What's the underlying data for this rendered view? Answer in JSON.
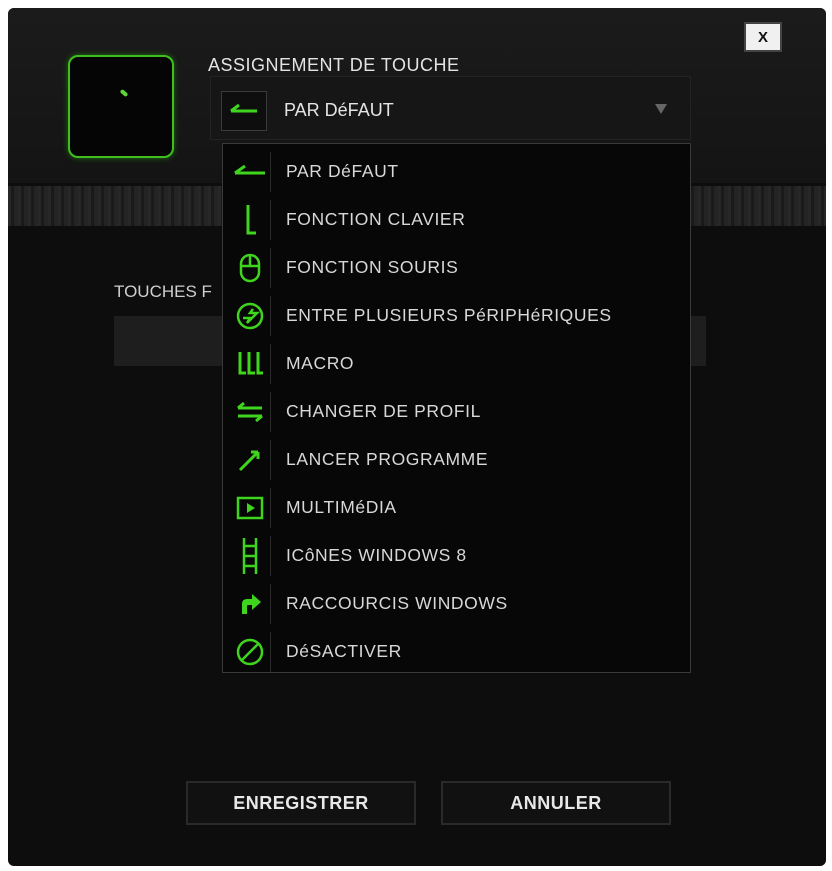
{
  "dialog": {
    "close_label": "X",
    "title": "ASSIGNEMENT DE TOUCHE",
    "side_label": "TOUCHES F",
    "accent_color": "#3fd51f"
  },
  "selector": {
    "value": "PAR DéFAUT",
    "icon": "default-arrow-icon"
  },
  "menu": {
    "items": [
      {
        "label": "PAR DéFAUT",
        "icon": "default-arrow-icon"
      },
      {
        "label": "FONCTION CLAVIER",
        "icon": "keyboard-function-icon"
      },
      {
        "label": "FONCTION SOURIS",
        "icon": "mouse-icon"
      },
      {
        "label": "ENTRE PLUSIEURS PéRIPHéRIQUES",
        "icon": "inter-device-icon"
      },
      {
        "label": "MACRO",
        "icon": "macro-icon"
      },
      {
        "label": "CHANGER DE PROFIL",
        "icon": "switch-profile-icon"
      },
      {
        "label": "LANCER PROGRAMME",
        "icon": "launch-program-icon"
      },
      {
        "label": "MULTIMéDIA",
        "icon": "multimedia-icon"
      },
      {
        "label": "ICôNES WINDOWS 8",
        "icon": "windows8-icon"
      },
      {
        "label": "RACCOURCIS WINDOWS",
        "icon": "windows-shortcut-icon"
      },
      {
        "label": "DéSACTIVER",
        "icon": "disable-icon"
      }
    ]
  },
  "buttons": {
    "save": "ENREGISTRER",
    "cancel": "ANNULER"
  }
}
